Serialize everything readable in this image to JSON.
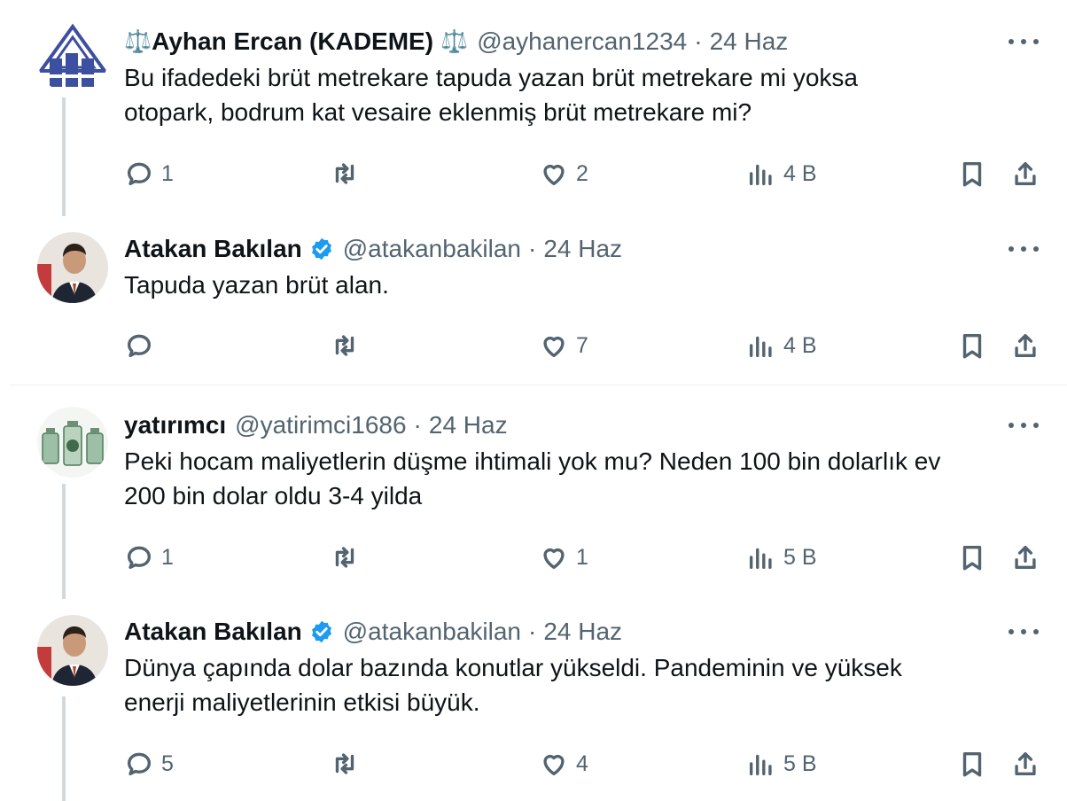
{
  "tweets": [
    {
      "name": "Ayhan Ercan (KADEME)",
      "name_prefix_emoji": "⚖️",
      "name_suffix_emoji": "⚖️",
      "handle": "@ayhanercan1234",
      "dot": "·",
      "time": "24 Haz",
      "verified": false,
      "text_lines": [
        "Bu ifadedeki brüt metrekare tapuda yazan brüt metrekare mi yoksa",
        "otopark, bodrum kat vesaire eklenmiş brüt metrekare mi?"
      ],
      "replies": "1",
      "retweets": "",
      "likes": "2",
      "views": "4 B",
      "avatar_icon": "kademe-logo"
    },
    {
      "name": "Atakan Bakılan",
      "handle": "@atakanbakilan",
      "dot": "·",
      "time": "24 Haz",
      "verified": true,
      "text_lines": [
        "Tapuda yazan brüt alan."
      ],
      "replies": "",
      "retweets": "",
      "likes": "7",
      "views": "4 B",
      "avatar_icon": "man-portrait"
    },
    {
      "name": "yatırımcı",
      "handle": "@yatirimci1686",
      "dot": "·",
      "time": "24 Haz",
      "verified": false,
      "text_lines": [
        "Peki hocam maliyetlerin düşme ihtimali yok mu? Neden 100 bin dolarlık ev",
        "200 bin dolar oldu 3-4 yilda"
      ],
      "replies": "1",
      "retweets": "",
      "likes": "1",
      "views": "5 B",
      "avatar_icon": "money-jars"
    },
    {
      "name": "Atakan Bakılan",
      "handle": "@atakanbakilan",
      "dot": "·",
      "time": "24 Haz",
      "verified": true,
      "text_lines": [
        "Dünya çapında dolar bazında konutlar yükseldi. Pandeminin ve yüksek",
        "enerji maliyetlerinin etkisi büyük."
      ],
      "replies": "5",
      "retweets": "",
      "likes": "4",
      "views": "5 B",
      "avatar_icon": "man-portrait"
    }
  ],
  "colors": {
    "text": "#0f1419",
    "secondary": "#536471",
    "verified": "#1d9bf0",
    "thread_line": "#cfd9de",
    "divider": "#eff3f4"
  }
}
